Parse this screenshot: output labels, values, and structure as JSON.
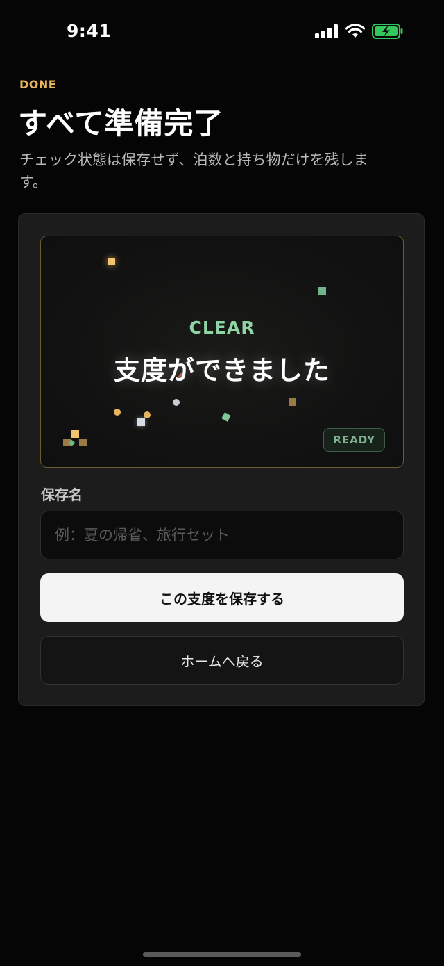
{
  "status_bar": {
    "time": "9:41"
  },
  "header": {
    "eyebrow": "DONE",
    "title": "すべて準備完了",
    "subtitle": "チェック状態は保存せず、泊数と持ち物だけを残します。"
  },
  "celebration": {
    "label": "CLEAR",
    "message": "支度ができました",
    "badge": "READY"
  },
  "form": {
    "name_label": "保存名",
    "name_value": "",
    "name_placeholder": "例：夏の帰省、旅行セット",
    "save_label": "この支度を保存する",
    "home_label": "ホームへ戻る"
  },
  "colors": {
    "accent_gold": "#e9b65c",
    "accent_green": "#8fd4a4",
    "background": "#050505",
    "card": "#1c1c1c",
    "battery": "#34c759"
  },
  "icons": [
    "cellular-signal-icon",
    "wifi-icon",
    "battery-charging-icon"
  ]
}
